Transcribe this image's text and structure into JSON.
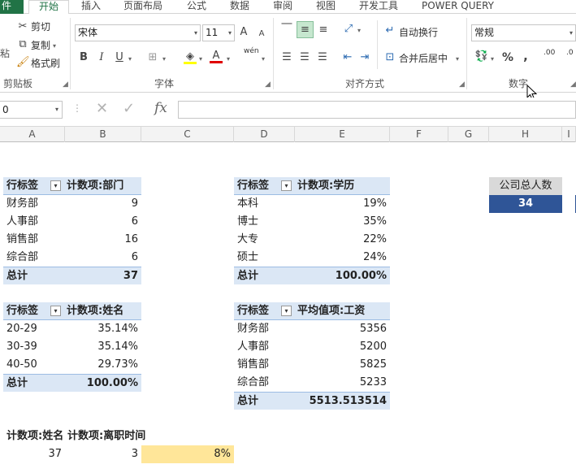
{
  "tabs": {
    "file": "件",
    "home": "开始",
    "insert": "插入",
    "layout": "页面布局",
    "formulas": "公式",
    "data": "数据",
    "review": "审阅",
    "view": "视图",
    "developer": "开发工具",
    "powerquery": "POWER QUERY"
  },
  "clipboard": {
    "cut": "剪切",
    "copy": "复制",
    "painter": "格式刷",
    "paste_partial": "粘",
    "group": "剪贴板"
  },
  "font": {
    "name": "宋体",
    "size": "11",
    "bold": "B",
    "italic": "I",
    "underline": "U",
    "grow": "A",
    "shrink": "A",
    "fontcolor": "A",
    "wen": "wén",
    "group": "字体"
  },
  "alignment": {
    "wrap": "自动换行",
    "merge": "合并后居中",
    "group": "对齐方式"
  },
  "number": {
    "format": "常规",
    "percent": "%",
    "comma": ",",
    "inc": ".00",
    "dec": ".0",
    "group": "数字"
  },
  "formulabar": {
    "namebox": "0",
    "fx": "fx",
    "content": ""
  },
  "columns": [
    "A",
    "B",
    "C",
    "D",
    "E",
    "F",
    "G",
    "H",
    "I"
  ],
  "pivot1": {
    "h1": "行标签",
    "h2": "计数项:部门",
    "rows": [
      [
        "财务部",
        "9"
      ],
      [
        "人事部",
        "6"
      ],
      [
        "销售部",
        "16"
      ],
      [
        "综合部",
        "6"
      ]
    ],
    "total": [
      "总计",
      "37"
    ]
  },
  "pivot2": {
    "h1": "行标签",
    "h2": "计数项:学历",
    "rows": [
      [
        "本科",
        "19%"
      ],
      [
        "博士",
        "35%"
      ],
      [
        "大专",
        "22%"
      ],
      [
        "硕士",
        "24%"
      ]
    ],
    "total": [
      "总计",
      "100.00%"
    ]
  },
  "pivot3": {
    "h1": "行标签",
    "h2": "计数项:姓名",
    "rows": [
      [
        "20-29",
        "35.14%"
      ],
      [
        "30-39",
        "35.14%"
      ],
      [
        "40-50",
        "29.73%"
      ]
    ],
    "total": [
      "总计",
      "100.00%"
    ]
  },
  "pivot4": {
    "h1": "行标签",
    "h2": "平均值项:工资",
    "rows": [
      [
        "财务部",
        "5356"
      ],
      [
        "人事部",
        "5200"
      ],
      [
        "销售部",
        "5825"
      ],
      [
        "综合部",
        "5233"
      ]
    ],
    "total": [
      "总计",
      "5513.513514"
    ]
  },
  "total_card": {
    "label": "公司总人数",
    "value": "34"
  },
  "pivot5": {
    "h1": "计数项:姓名",
    "h2": "计数项:离职时间",
    "v1": "37",
    "v2": "3",
    "rate": "8%"
  },
  "colors": {
    "excel_green": "#217346",
    "pivot_header": "#dbe7f5",
    "card_value_bg": "#2f5597",
    "rate_bg": "#ffe699"
  }
}
